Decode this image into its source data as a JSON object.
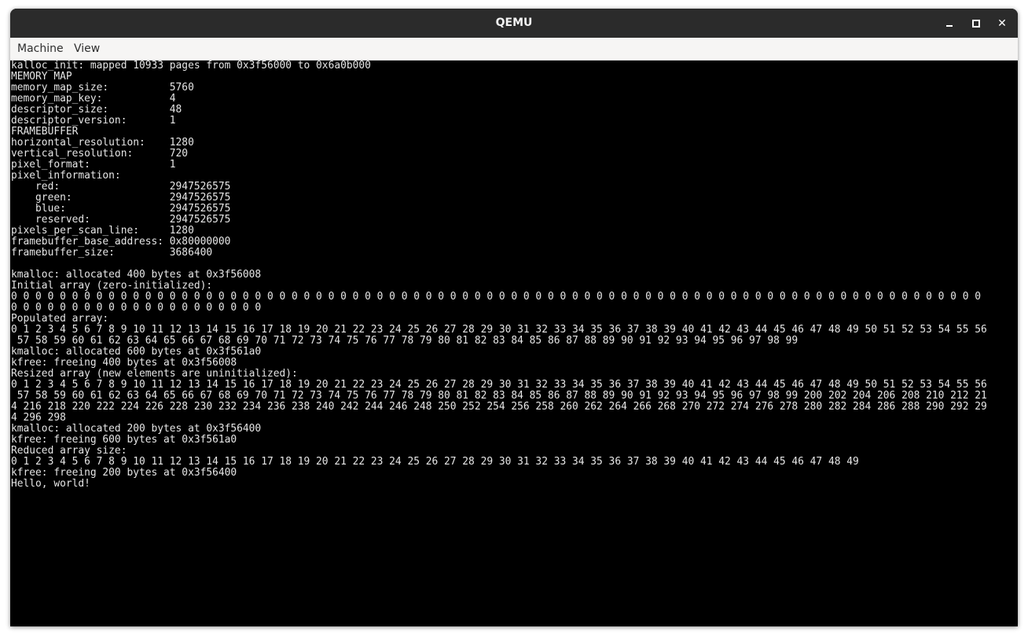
{
  "window": {
    "title": "QEMU"
  },
  "menubar": {
    "items": [
      "Machine",
      "View"
    ]
  },
  "console": {
    "lines": [
      "kalloc_init: mapped 10933 pages from 0x3f56000 to 0x6a0b000",
      "MEMORY MAP",
      "memory_map_size:          5760",
      "memory_map_key:           4",
      "descriptor_size:          48",
      "descriptor_version:       1",
      "FRAMEBUFFER",
      "horizontal_resolution:    1280",
      "vertical_resolution:      720",
      "pixel_format:             1",
      "pixel_information:",
      "    red:                  2947526575",
      "    green:                2947526575",
      "    blue:                 2947526575",
      "    reserved:             2947526575",
      "pixels_per_scan_line:     1280",
      "framebuffer_base_address: 0x80000000",
      "framebuffer_size:         3686400",
      "",
      "kmalloc: allocated 400 bytes at 0x3f56008",
      "Initial array (zero-initialized):",
      "0 0 0 0 0 0 0 0 0 0 0 0 0 0 0 0 0 0 0 0 0 0 0 0 0 0 0 0 0 0 0 0 0 0 0 0 0 0 0 0 0 0 0 0 0 0 0 0 0 0 0 0 0 0 0 0 0 0 0 0 0 0 0 0 0 0 0 0 0 0 0 0 0 0 0 0 0 0 0 0",
      "0 0 0 0 0 0 0 0 0 0 0 0 0 0 0 0 0 0 0 0 0",
      "Populated array:",
      "0 1 2 3 4 5 6 7 8 9 10 11 12 13 14 15 16 17 18 19 20 21 22 23 24 25 26 27 28 29 30 31 32 33 34 35 36 37 38 39 40 41 42 43 44 45 46 47 48 49 50 51 52 53 54 55 56",
      " 57 58 59 60 61 62 63 64 65 66 67 68 69 70 71 72 73 74 75 76 77 78 79 80 81 82 83 84 85 86 87 88 89 90 91 92 93 94 95 96 97 98 99",
      "kmalloc: allocated 600 bytes at 0x3f561a0",
      "kfree: freeing 400 bytes at 0x3f56008",
      "Resized array (new elements are uninitialized):",
      "0 1 2 3 4 5 6 7 8 9 10 11 12 13 14 15 16 17 18 19 20 21 22 23 24 25 26 27 28 29 30 31 32 33 34 35 36 37 38 39 40 41 42 43 44 45 46 47 48 49 50 51 52 53 54 55 56",
      " 57 58 59 60 61 62 63 64 65 66 67 68 69 70 71 72 73 74 75 76 77 78 79 80 81 82 83 84 85 86 87 88 89 90 91 92 93 94 95 96 97 98 99 200 202 204 206 208 210 212 21",
      "4 216 218 220 222 224 226 228 230 232 234 236 238 240 242 244 246 248 250 252 254 256 258 260 262 264 266 268 270 272 274 276 278 280 282 284 286 288 290 292 29",
      "4 296 298",
      "kmalloc: allocated 200 bytes at 0x3f56400",
      "kfree: freeing 600 bytes at 0x3f561a0",
      "Reduced array size:",
      "0 1 2 3 4 5 6 7 8 9 10 11 12 13 14 15 16 17 18 19 20 21 22 23 24 25 26 27 28 29 30 31 32 33 34 35 36 37 38 39 40 41 42 43 44 45 46 47 48 49",
      "kfree: freeing 200 bytes at 0x3f56400",
      "Hello, world!"
    ]
  }
}
